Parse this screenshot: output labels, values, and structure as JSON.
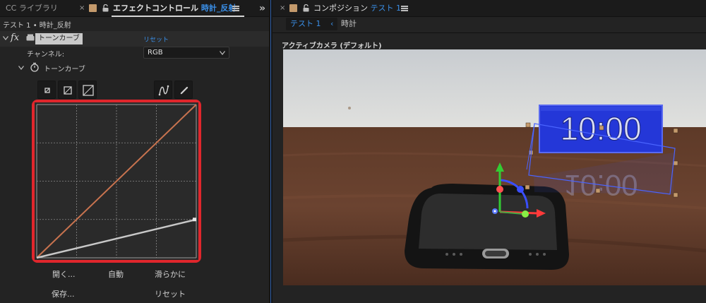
{
  "left_panel": {
    "tabs": [
      {
        "label": "CC ライブラリ"
      },
      {
        "close": "×",
        "label": "エフェクトコントロール",
        "comp": "時計_反射"
      }
    ],
    "more_glyph": "»",
    "breadcrumb": "テスト 1 • 時計_反射",
    "effect": {
      "fx_glyph": "fx",
      "name": "トーンカーブ",
      "reset": "リセット"
    },
    "channel": {
      "label": "チャンネル:",
      "value": "RGB"
    },
    "property": {
      "label": "トーンカーブ"
    },
    "buttons": {
      "open": "開く...",
      "auto": "自動",
      "smooth": "滑らかに",
      "save": "保存...",
      "reset": "リセット"
    },
    "curve": {
      "grid_divisions": 4,
      "red_line": {
        "from": [
          0,
          0
        ],
        "to": [
          1,
          1
        ],
        "color": "#c8734f"
      },
      "white_line": {
        "from": [
          0,
          0
        ],
        "to": [
          1,
          0.25
        ],
        "color": "#c8c8c8"
      },
      "highlight_color": "#e0262c"
    }
  },
  "right_panel": {
    "tab": {
      "close": "×",
      "label": "コンポジション",
      "comp": "テスト 1"
    },
    "subtabs": {
      "active": "テスト 1",
      "chev": "‹",
      "other": "時計"
    },
    "camera_label": "アクティブカメラ (デフォルト)",
    "viewer": {
      "clock_text": "10:00",
      "reflection_text": "10:00"
    }
  },
  "colors": {
    "accent": "#3a8fe8",
    "brand_tan": "#c49a6c"
  }
}
